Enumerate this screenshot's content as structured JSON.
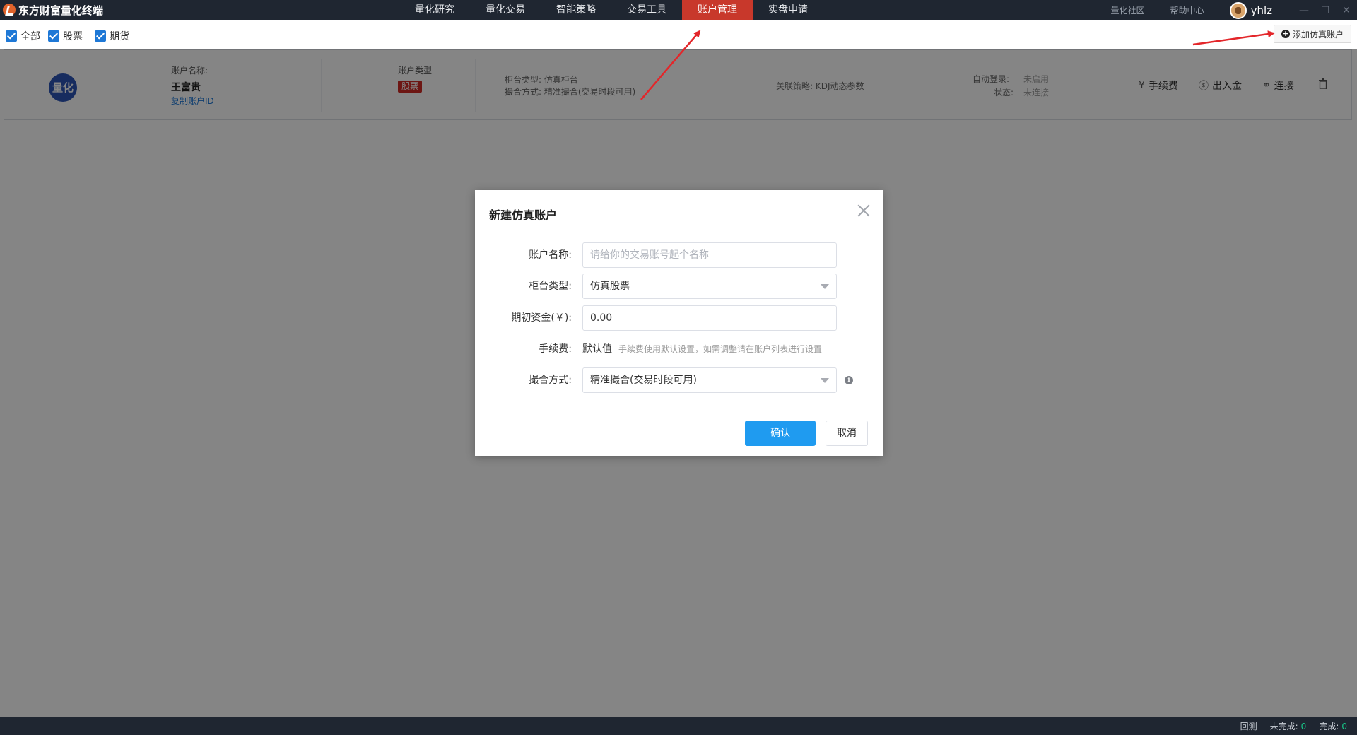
{
  "app": {
    "title": "东方财富量化终端"
  },
  "nav": {
    "items": [
      "量化研究",
      "量化交易",
      "智能策略",
      "交易工具",
      "账户管理",
      "实盘申请"
    ],
    "active_index": 4
  },
  "top_right": {
    "community": "量化社区",
    "help": "帮助中心",
    "username": "yhlz"
  },
  "filters": {
    "all": "全部",
    "stock": "股票",
    "futures": "期货",
    "add_button": "添加仿真账户"
  },
  "account": {
    "logo_text": "量化",
    "name_label": "账户名称:",
    "name": "王富贵",
    "copy_id": "复制账户ID",
    "type_label": "账户类型",
    "type_tag": "股票",
    "counter_type": "柜台类型:   仿真柜台",
    "match_mode": "撮合方式:   精准撮合(交易时段可用)",
    "strategy": "关联策略:   KDJ动态参数",
    "auto_login_label": "自动登录:",
    "auto_login_value": "未启用",
    "status_label": "状态:",
    "status_value": "未连接",
    "actions": {
      "fee": "手续费",
      "funds": "出入金",
      "connect": "连接"
    }
  },
  "modal": {
    "title": "新建仿真账户",
    "name_label": "账户名称:",
    "name_placeholder": "请给你的交易账号起个名称",
    "counter_label": "柜台类型:",
    "counter_value": "仿真股票",
    "capital_label": "期初资金(￥):",
    "capital_value": "0.00",
    "fee_label": "手续费:",
    "fee_value": "默认值",
    "fee_note": "手续费使用默认设置，如需调整请在账户列表进行设置",
    "match_label": "撮合方式:",
    "match_value": "精准撮合(交易时段可用)",
    "confirm": "确认",
    "cancel": "取消"
  },
  "statusbar": {
    "backtest": "回测",
    "pending_label": "未完成:",
    "pending": "0",
    "done_label": "完成:",
    "done": "0"
  },
  "colors": {
    "topbar": "#1f2631",
    "active_tab": "#c8382b",
    "primary": "#1f9bf0",
    "tag": "#d22b25",
    "annotation_arrow": "#e3262a"
  }
}
